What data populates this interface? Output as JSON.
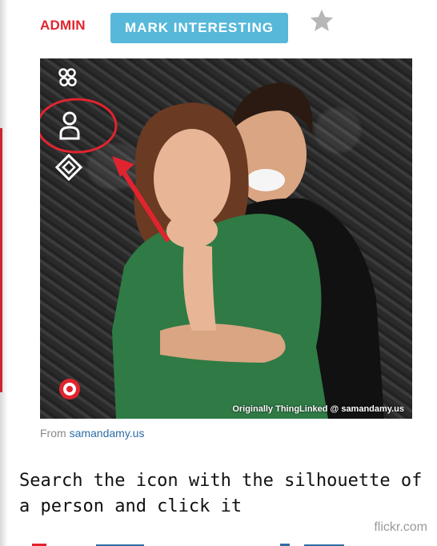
{
  "header": {
    "admin_label": "ADMIN",
    "mark_button_label": "MARK INTERESTING",
    "star_icon": "star-icon"
  },
  "photo": {
    "icons": [
      "group-icon",
      "person-icon",
      "diamond-link-icon",
      "record-icon"
    ],
    "credit": "Originally ThingLinked @ samandamy.us",
    "highlight_color": "#e0242f"
  },
  "source": {
    "prefix": "From",
    "link": "samandamy.us"
  },
  "instruction": "Search the icon with the silhouette of a person and click it",
  "watermark": "flickr.com",
  "colors": {
    "admin": "#e0242f",
    "button": "#57b8d9",
    "link": "#2e6da4"
  }
}
